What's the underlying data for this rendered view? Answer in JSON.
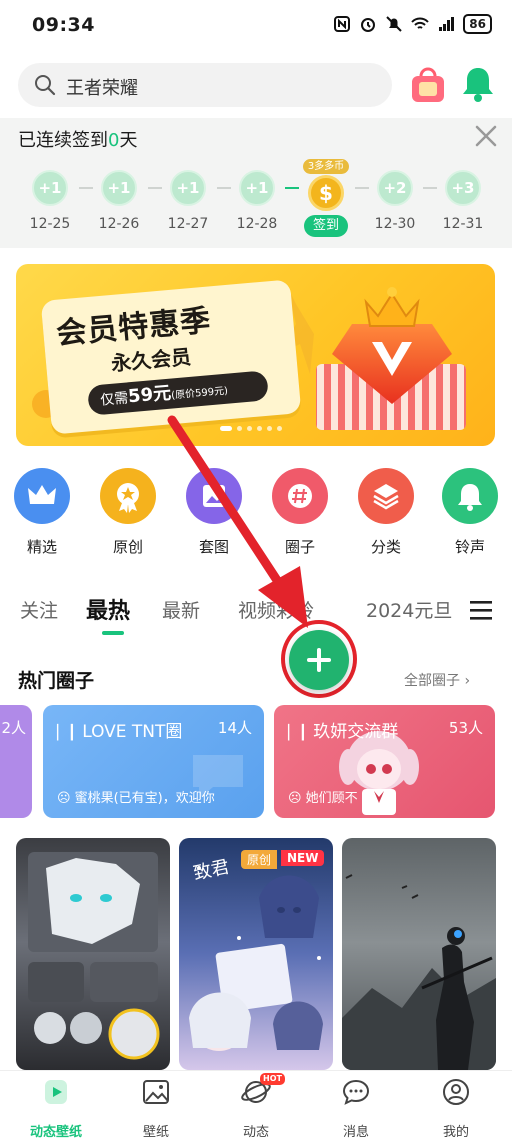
{
  "status": {
    "time": "09:34",
    "battery": "86"
  },
  "search": {
    "placeholder": "王者荣耀"
  },
  "checkin": {
    "prefix": "已连续签到",
    "days": "0",
    "suffix": "天",
    "items": [
      {
        "reward": "+1",
        "date": "12-25"
      },
      {
        "reward": "+1",
        "date": "12-26"
      },
      {
        "reward": "+1",
        "date": "12-27"
      },
      {
        "reward": "+1",
        "date": "12-28"
      },
      {
        "reward": "+2",
        "date": "12-30"
      },
      {
        "reward": "+3",
        "date": "12-31"
      }
    ],
    "today": {
      "badge": "3多多币",
      "icon": "$",
      "button": "签到"
    }
  },
  "banner": {
    "title": "会员特惠季",
    "subtitle": "永久会员",
    "price_prefix": "仅需",
    "price": "59元",
    "original": "(原价599元)"
  },
  "categories": [
    {
      "label": "精选",
      "icon": "crown-icon",
      "color": "#4a8ff0"
    },
    {
      "label": "原创",
      "icon": "medal-icon",
      "color": "#f5b21d"
    },
    {
      "label": "套图",
      "icon": "album-icon",
      "color": "#8565e8"
    },
    {
      "label": "圈子",
      "icon": "hash-icon",
      "color": "#f05a6a"
    },
    {
      "label": "分类",
      "icon": "layers-icon",
      "color": "#f05d4b"
    },
    {
      "label": "铃声",
      "icon": "bell-icon",
      "color": "#2cc27d"
    }
  ],
  "tabs": [
    "关注",
    "最热",
    "最新",
    "视频彩铃",
    "2024元旦"
  ],
  "section": {
    "title": "热门圈子",
    "more": "全部圈子"
  },
  "circles": [
    {
      "name": "",
      "count": "2人",
      "message": ""
    },
    {
      "name": "LOVE  TNT圈",
      "count": "14人",
      "message": "蜜桃果(已有宝)，欢迎你"
    },
    {
      "name": "玖妍交流群",
      "count": "53人",
      "message": "她们顾不"
    }
  ],
  "wallpapers": [
    {
      "badge": ""
    },
    {
      "badge": "原创",
      "badge2": "NEW",
      "caption": "致君"
    },
    {
      "badge": ""
    }
  ],
  "bottom_nav": [
    {
      "label": "动态壁纸",
      "active": true
    },
    {
      "label": "壁纸",
      "active": false
    },
    {
      "label": "动态",
      "active": false,
      "badge": "HOT"
    },
    {
      "label": "消息",
      "active": false
    },
    {
      "label": "我的",
      "active": false
    }
  ],
  "colors": {
    "brand_green": "#19c37d",
    "fab_green": "#21b36f",
    "annotation_red": "#e3232b"
  }
}
